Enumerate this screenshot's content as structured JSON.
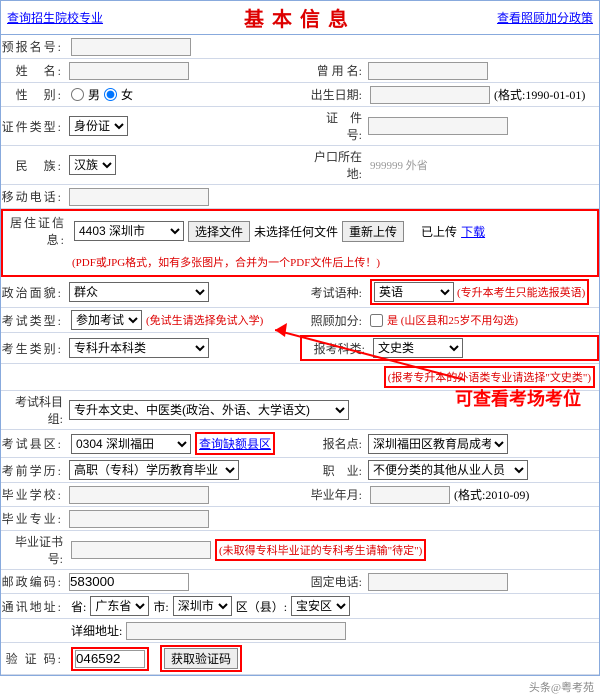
{
  "header": {
    "left_link": "查询招生院校专业",
    "title": "基本信息",
    "right_link": "查看照顾加分政策"
  },
  "labels": {
    "prereg": "预报名号:",
    "name": "姓　名:",
    "alias": "曾 用 名:",
    "gender": "性　别:",
    "male": "男",
    "female": "女",
    "birth": "出生日期:",
    "birth_hint": "(格式:1990-01-01)",
    "idtype": "证件类型:",
    "idtype_val": "身份证",
    "idno": "证　件　号:",
    "ethnic": "民　族:",
    "ethnic_val": "汉族",
    "census": "户口所在地:",
    "census_val": "999999 外省",
    "mobile": "移动电话:",
    "residence": "居住证信息:",
    "res_city": "4403 深圳市",
    "sel_file": "选择文件",
    "no_file": "未选择任何文件",
    "reupload": "重新上传",
    "uploaded": "已上传",
    "download": "下载",
    "res_hint": "(PDF或JPG格式，如有多张图片，合并为一个PDF文件后上传！)",
    "political": "政治面貌:",
    "political_val": "群众",
    "exam_lang": "考试语种:",
    "exam_lang_val": "英语",
    "lang_hint": "(专升本考生只能选报英语)",
    "exam_type": "考试类型:",
    "exam_type_val": "参加考试",
    "exam_type_hint": "(免试生请选择免试入学)",
    "bonus": "照顾加分:",
    "bonus_txt": "是 (山区县和25岁不用勾选)",
    "candidate_type": "考生类别:",
    "candidate_type_val": "专科升本科类",
    "subject": "报考科类:",
    "subject_val": "文史类",
    "subject_hint": "(报考专升本的外语类专业请选择\"文史类\")",
    "subject_group": "考试科目组:",
    "subject_group_val": "专升本文史、中医类(政治、外语、大学语文)",
    "exam_district": "考试县区:",
    "exam_district_val": "0304 深圳福田",
    "query_district": "查询缺额县区",
    "exam_point": "报名点:",
    "exam_point_val": "深圳福田区教育局成考",
    "pre_edu": "考前学历:",
    "pre_edu_val": "高职（专科）学历教育毕业",
    "occupation": "职　业:",
    "occupation_val": "不便分类的其他从业人员",
    "grad_school": "毕业学校:",
    "grad_date": "毕业年月:",
    "grad_date_hint": "(格式:2010-09)",
    "grad_major": "毕业专业:",
    "grad_cert": "毕业证书号:",
    "cert_hint": "(未取得专科毕业证的专科考生请输\"待定\")",
    "postcode": "邮政编码:",
    "postcode_val": "583000",
    "phone": "固定电话:",
    "address": "通讯地址:",
    "province": "省:",
    "province_val": "广东省",
    "city": "市:",
    "city_val": "深圳市",
    "county": "区（县）:",
    "county_val": "宝安区",
    "detail_addr": "详细地址:",
    "captcha": "验 证 码:",
    "captcha_val": "046592",
    "get_code": "获取验证码"
  },
  "annotation": {
    "text": "可查看考场考位"
  },
  "footer": "头条@粤考苑"
}
